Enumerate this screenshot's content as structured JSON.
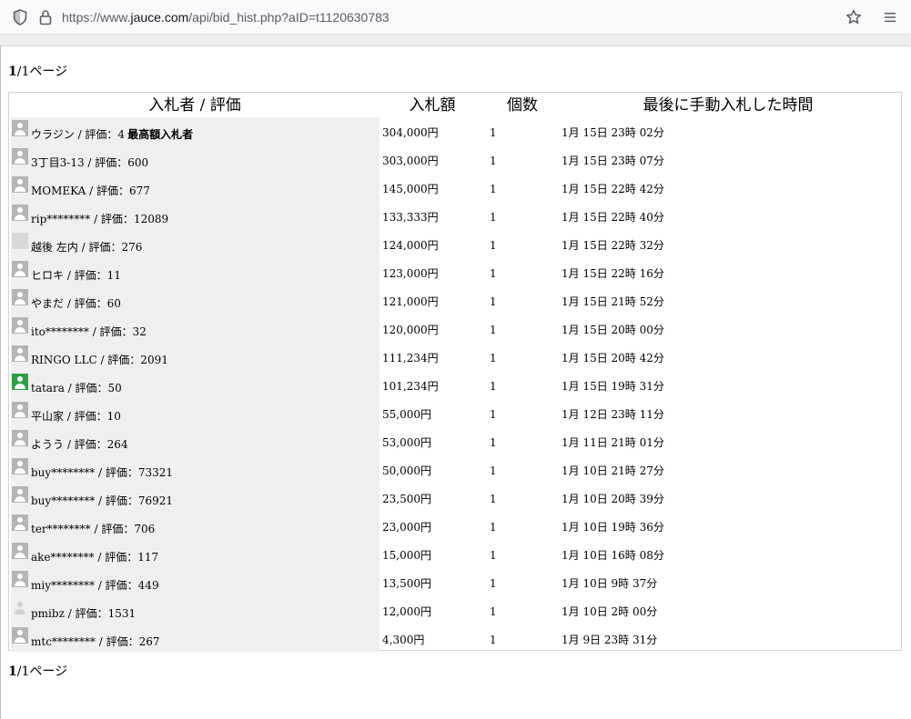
{
  "browser": {
    "url_prefix": "https://www.",
    "url_host": "jauce.com",
    "url_path": "/api/bid_hist.php?aID=t1120630783",
    "shield_icon": "shield-icon",
    "lock_icon": "lock-icon",
    "star_icon": "bookmark-star-icon",
    "menu_icon": "hamburger-menu-icon"
  },
  "pager": {
    "current": "1",
    "rest": "/1ページ"
  },
  "table": {
    "headers": {
      "bidder": "入札者 / 評価",
      "amount": "入札額",
      "quantity": "個数",
      "time": "最後に手動入札した時間"
    },
    "top_bidder_label": "最高額入札者",
    "rows": [
      {
        "bidder": "ウラジン / 評価：4",
        "amount": "304,000円",
        "quantity": "1",
        "time": "1月 15日 23時 02分",
        "avatar": "gray"
      },
      {
        "bidder": "3丁目3-13 / 評価：600",
        "amount": "303,000円",
        "quantity": "1",
        "time": "1月 15日 23時 07分",
        "avatar": "gray"
      },
      {
        "bidder": "MOMEKA / 評価：677",
        "amount": "145,000円",
        "quantity": "1",
        "time": "1月 15日 22時 42分",
        "avatar": "gray"
      },
      {
        "bidder": "rip******** / 評価：12089",
        "amount": "133,333円",
        "quantity": "1",
        "time": "1月 15日 22時 40分",
        "avatar": "gray"
      },
      {
        "bidder": "越後 左内 / 評価：276",
        "amount": "124,000円",
        "quantity": "1",
        "time": "1月 15日 22時 32分",
        "avatar": "plain"
      },
      {
        "bidder": "ヒロキ / 評価：11",
        "amount": "123,000円",
        "quantity": "1",
        "time": "1月 15日 22時 16分",
        "avatar": "gray"
      },
      {
        "bidder": "やまだ / 評価：60",
        "amount": "121,000円",
        "quantity": "1",
        "time": "1月 15日 21時 52分",
        "avatar": "gray"
      },
      {
        "bidder": "ito******** / 評価：32",
        "amount": "120,000円",
        "quantity": "1",
        "time": "1月 15日 20時 00分",
        "avatar": "gray"
      },
      {
        "bidder": "RINGO LLC / 評価：2091",
        "amount": "111,234円",
        "quantity": "1",
        "time": "1月 15日 20時 42分",
        "avatar": "gray"
      },
      {
        "bidder": "tatara / 評価：50",
        "amount": "101,234円",
        "quantity": "1",
        "time": "1月 15日 19時 31分",
        "avatar": "green"
      },
      {
        "bidder": "平山家 / 評価：10",
        "amount": "55,000円",
        "quantity": "1",
        "time": "1月 12日 23時 11分",
        "avatar": "gray"
      },
      {
        "bidder": "ようう / 評価：264",
        "amount": "53,000円",
        "quantity": "1",
        "time": "1月 11日 21時 01分",
        "avatar": "gray"
      },
      {
        "bidder": "buy******** / 評価：73321",
        "amount": "50,000円",
        "quantity": "1",
        "time": "1月 10日 21時 27分",
        "avatar": "gray"
      },
      {
        "bidder": "buy******** / 評価：76921",
        "amount": "23,500円",
        "quantity": "1",
        "time": "1月 10日 20時 39分",
        "avatar": "gray"
      },
      {
        "bidder": "ter******** / 評価：706",
        "amount": "23,000円",
        "quantity": "1",
        "time": "1月 10日 19時 36分",
        "avatar": "gray"
      },
      {
        "bidder": "ake******** / 評価：117",
        "amount": "15,000円",
        "quantity": "1",
        "time": "1月 10日 16時 08分",
        "avatar": "gray"
      },
      {
        "bidder": "miy******** / 評価：449",
        "amount": "13,500円",
        "quantity": "1",
        "time": "1月 10日 9時 37分",
        "avatar": "gray"
      },
      {
        "bidder": "pmibz / 評価：1531",
        "amount": "12,000円",
        "quantity": "1",
        "time": "1月 10日 2時 00分",
        "avatar": "round"
      },
      {
        "bidder": "mtc******** / 評価：267",
        "amount": "4,300円",
        "quantity": "1",
        "time": "1月 9日 23時 31分",
        "avatar": "gray"
      }
    ]
  }
}
